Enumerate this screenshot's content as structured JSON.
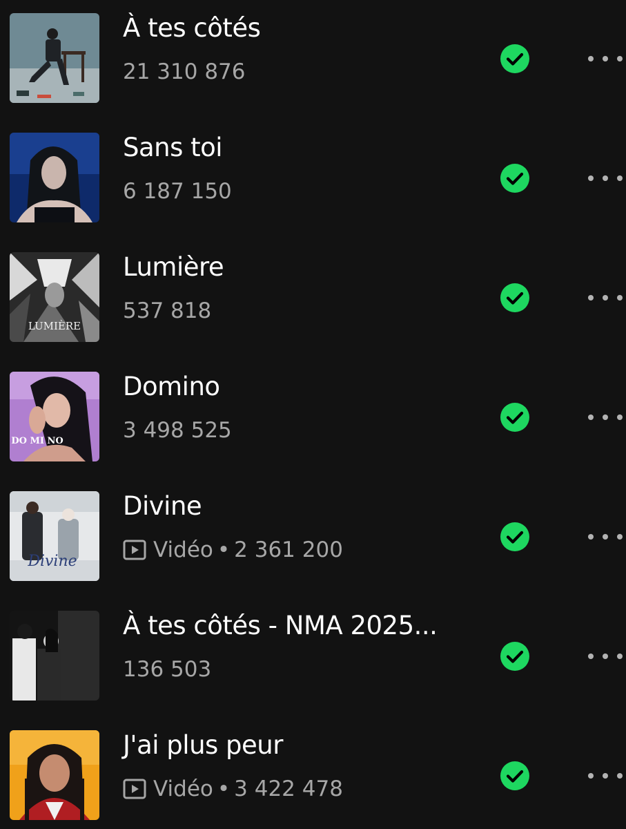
{
  "tracks": [
    {
      "title": "À tes côtés",
      "plays": "21 310 876",
      "is_video": false,
      "downloaded": true,
      "cover": "album-cover-man-on-chair"
    },
    {
      "title": "Sans toi",
      "plays": "6 187 150",
      "is_video": false,
      "downloaded": true,
      "cover": "album-cover-woman-blue"
    },
    {
      "title": "Lumière",
      "plays": "537 818",
      "is_video": false,
      "downloaded": true,
      "cover": "album-cover-lumiere",
      "cover_text": "LUMIÈRE"
    },
    {
      "title": "Domino",
      "plays": "3 498 525",
      "is_video": false,
      "downloaded": true,
      "cover": "album-cover-domino",
      "cover_text": "DO MI NO"
    },
    {
      "title": "Divine",
      "video_label": "Vidéo",
      "plays": "2 361 200",
      "is_video": true,
      "downloaded": true,
      "cover": "album-cover-divine",
      "cover_text": "Divine"
    },
    {
      "title": "À tes côtés - NMA 2025...",
      "plays": "136 503",
      "is_video": false,
      "downloaded": true,
      "cover": "album-cover-duo-bw"
    },
    {
      "title": "J'ai plus peur",
      "video_label": "Vidéo",
      "plays": "3 422 478",
      "is_video": true,
      "downloaded": true,
      "cover": "album-cover-orange-portrait"
    }
  ],
  "colors": {
    "background": "#121212",
    "title": "#ffffff",
    "meta": "#a7a7a7",
    "downloaded_check": "#1ed760",
    "more_dots": "#b3b3b3"
  },
  "icons": {
    "downloaded": "check-circle-icon",
    "more": "more-options-icon",
    "video": "video-play-icon"
  }
}
